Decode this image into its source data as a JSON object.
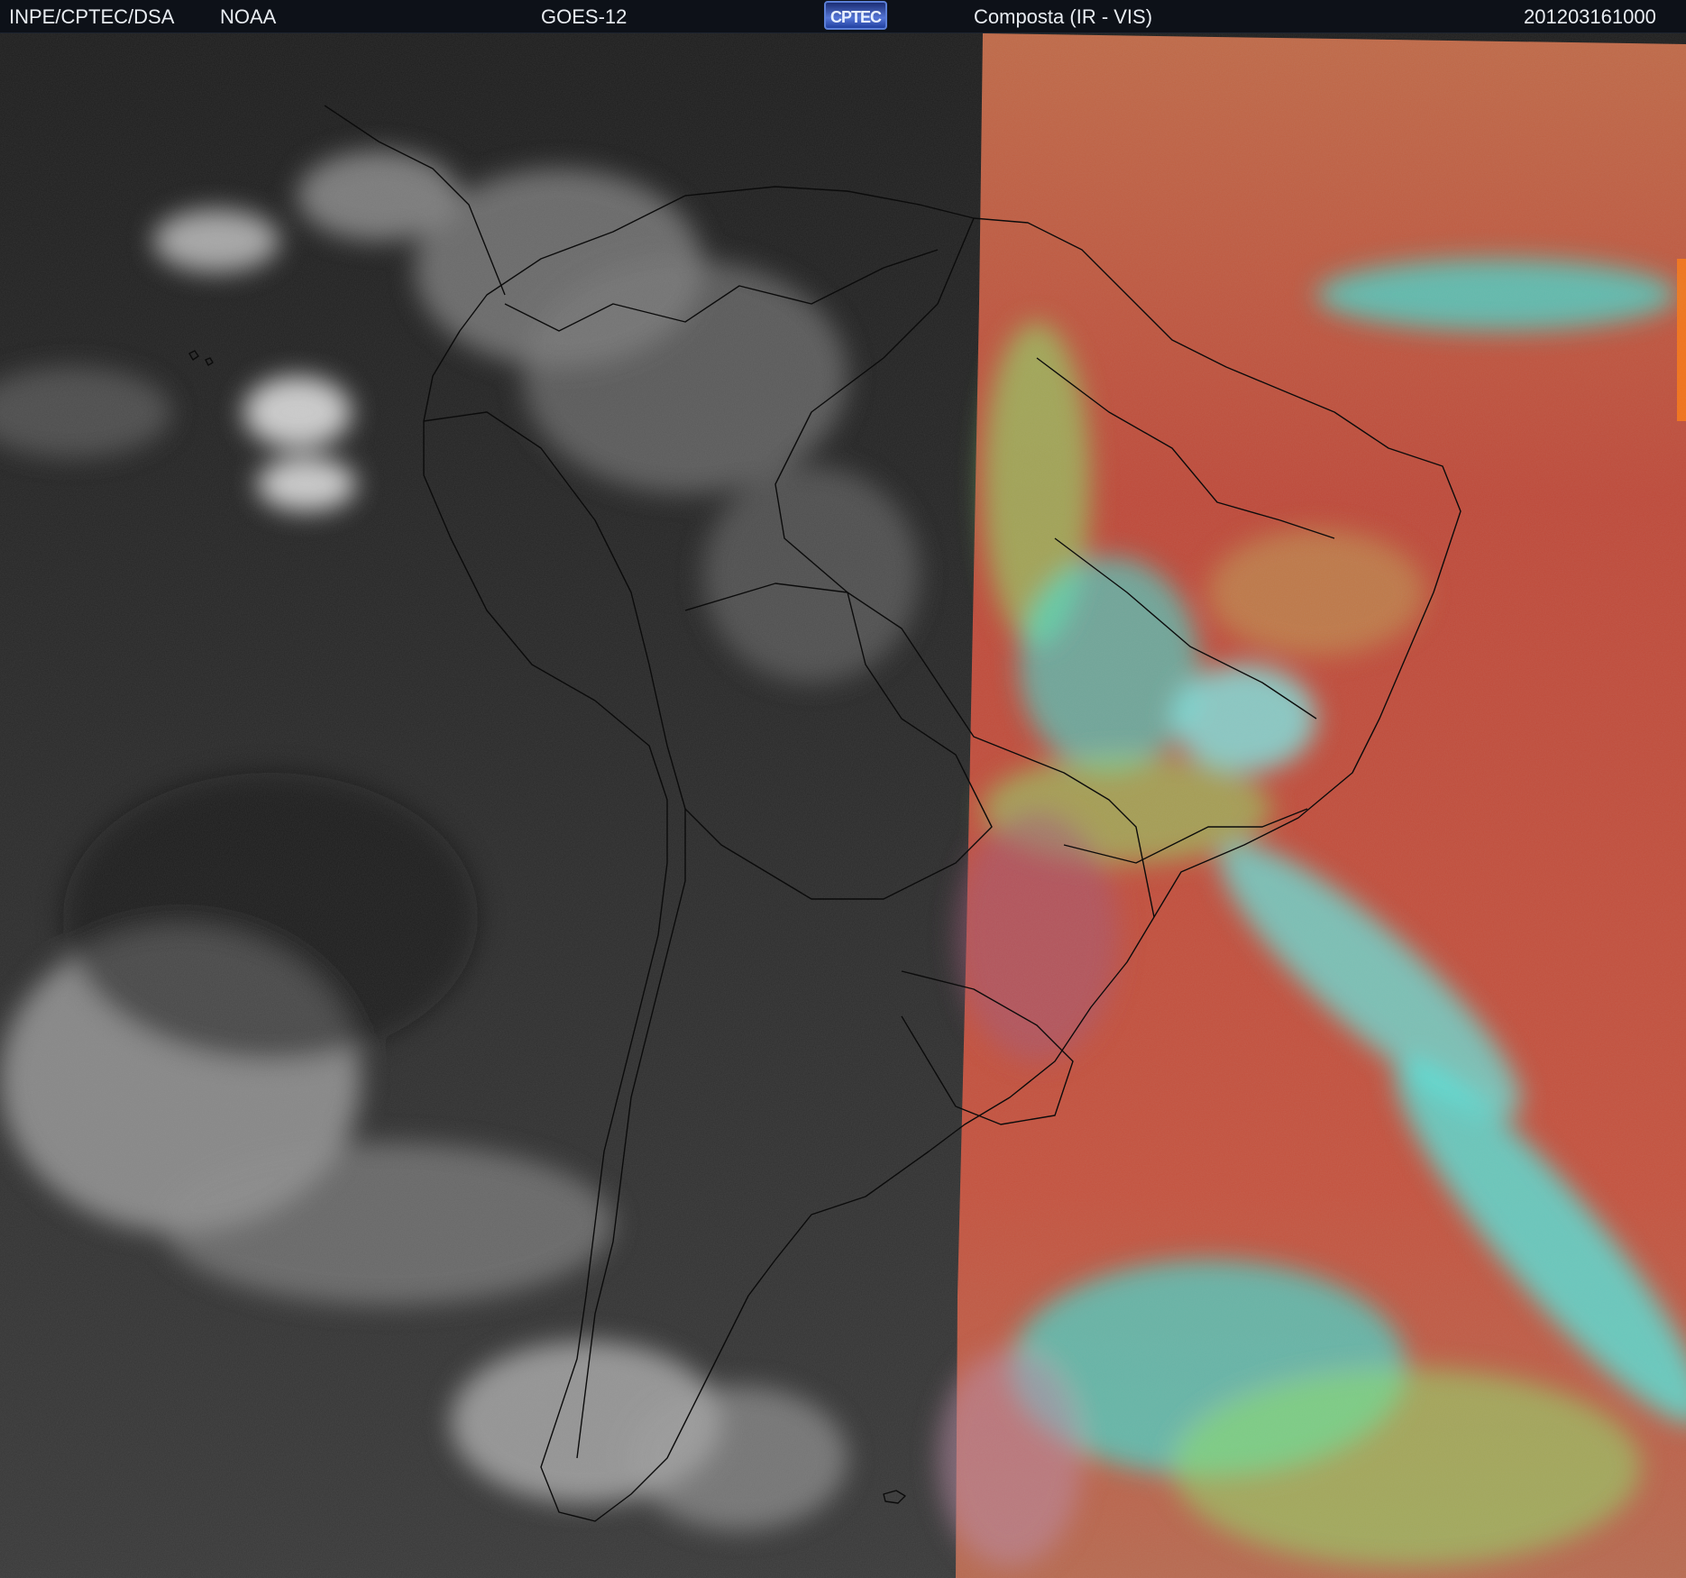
{
  "header": {
    "source_label": "INPE/CPTEC/DSA",
    "agency_label": "NOAA",
    "satellite_label": "GOES-12",
    "logo_text": "CPTEC",
    "product_label": "Composta (IR - VIS)",
    "timestamp_label": "201203161000"
  },
  "imagery": {
    "ir_panel_colors": [
      "#1a1a1a",
      "#3c3c3c",
      "#9b9b9b",
      "#e9e9e9"
    ],
    "vis_panel_colors": [
      "#bf4a3a",
      "#c6553f",
      "#a35a7a",
      "#8fe06a",
      "#2ff0e8",
      "#78f2f0"
    ],
    "map_outline_color": "#0b0b0b"
  }
}
